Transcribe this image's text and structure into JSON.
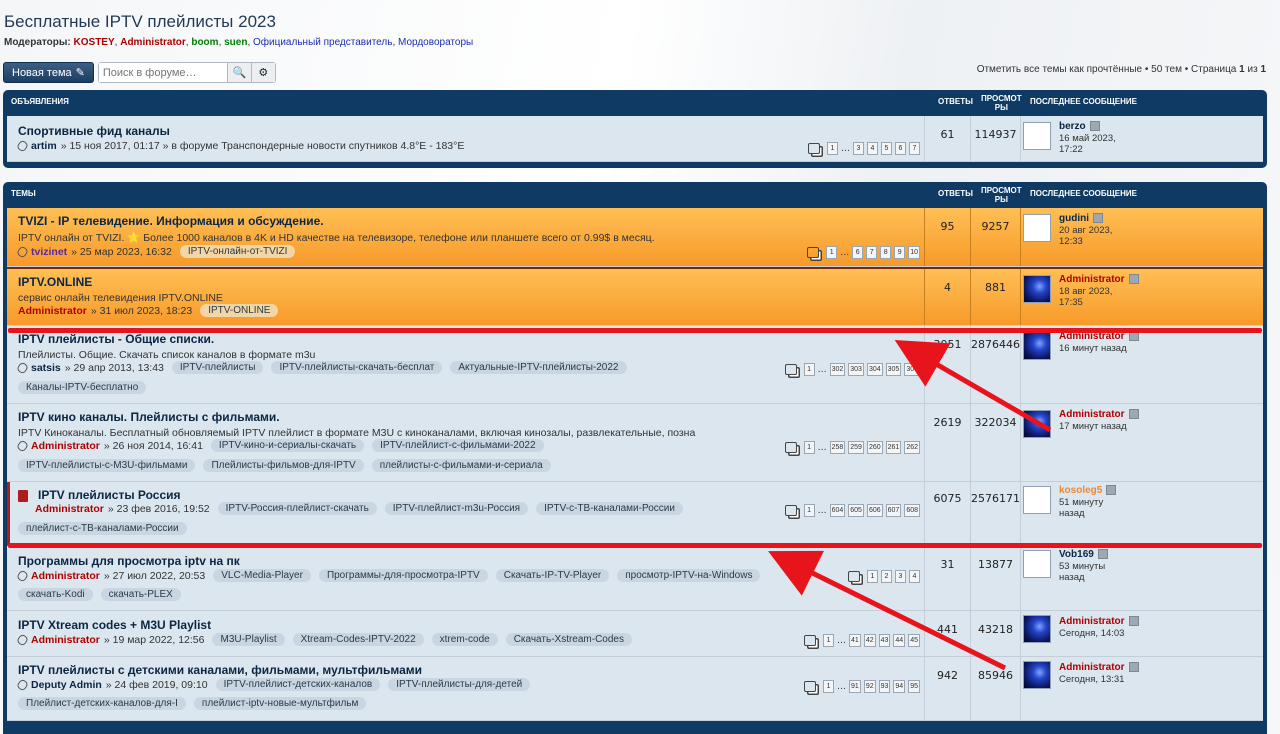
{
  "forum_title": "Бесплатные IPTV плейлисты 2023",
  "moderators": {
    "label": "Модераторы:",
    "list": [
      {
        "name": "KOSTEY",
        "color": "#b00000"
      },
      {
        "name": "Administrator",
        "color": "#b00000"
      },
      {
        "name": "boom",
        "color": "#008000"
      },
      {
        "name": "suen",
        "color": "#008000"
      },
      {
        "name": "Официальный представитель",
        "color": "#1d2eb0"
      },
      {
        "name": "Мордовораторы",
        "color": "#1d2eb0"
      }
    ]
  },
  "toolbar": {
    "new_topic": "Новая тема",
    "search_placeholder": "Поиск в форуме…",
    "mark_read": "Отметить все темы как прочтённые",
    "topics_count": "50 тем",
    "page_label": "Страница",
    "page_current": "1",
    "page_of": "из",
    "page_total": "1"
  },
  "columns": {
    "answers": "ОТВЕТЫ",
    "views_1": "ПРОСМОТ",
    "views_2": "РЫ",
    "last": "ПОСЛЕДНЕЕ СООБЩЕНИЕ"
  },
  "announcements": {
    "header": "ОБЪЯВЛЕНИЯ",
    "topics": [
      {
        "title": "Спортивные фид каналы",
        "author": "artim",
        "date": "» 15 ноя 2017, 01:17 » в форуме Транспондерные новости спутников 4.8°E - 183°E",
        "pages": [
          "1",
          "3",
          "4",
          "5",
          "6",
          "7"
        ],
        "replies": "61",
        "views": "114937",
        "last_author": "berzo",
        "last_date_1": "16 май 2023,",
        "last_date_2": "17:22"
      }
    ]
  },
  "topics_section": {
    "header": "ТЕМЫ",
    "topics": [
      {
        "title": "TVIZI - IP телевидение. Информация и обсуждение.",
        "desc": "IPTV онлайн от TVIZI. ⭐ Более 1000 каналов в 4K и HD качестве на телевизоре, телефоне или планшете всего от 0.99$ в месяц.",
        "author": "tvizinet",
        "date": "» 25 мар 2023, 16:32",
        "tags": [
          "IPTV-онлайн-от-TVIZI"
        ],
        "pages": [
          "1",
          "6",
          "7",
          "8",
          "9",
          "10"
        ],
        "replies": "95",
        "views": "9257",
        "last_author": "gudini",
        "last_date_1": "20 авг 2023,",
        "last_date_2": "12:33"
      },
      {
        "title": "IPTV.ONLINE",
        "desc": "сервис онлайн телевидения IPTV.ONLINE",
        "author": "Administrator",
        "date": "» 31 июл 2023, 18:23",
        "tags": [
          "IPTV-ONLINE"
        ],
        "replies": "4",
        "views": "881",
        "last_author": "Administrator",
        "last_date_1": "18 авг 2023,",
        "last_date_2": "17:35"
      },
      {
        "title": "IPTV плейлисты - Общие списки.",
        "desc": "Плейлисты. Общие. Скачать список каналов в формате m3u",
        "author": "satsis",
        "date": "» 29 апр 2013, 13:43",
        "tags": [
          "IPTV-плейлисты",
          "IPTV-плейлисты-скачать-бесплат",
          "Актуальные-IPTV-плейлисты-2022"
        ],
        "tags2": [
          "Каналы-IPTV-бесплатно"
        ],
        "pages": [
          "1",
          "302",
          "303",
          "304",
          "305",
          "306"
        ],
        "replies": "3051",
        "views": "2876446",
        "last_author": "Administrator",
        "last_date_1": "16 минут назад",
        "last_date_2": ""
      },
      {
        "title": "IPTV кино каналы. Плейлисты с фильмами.",
        "desc": "IPTV Киноканалы. Бесплатный обновляемый IPTV плейлист в формате M3U с киноканалами, включая кинозалы, развлекательные, позна",
        "author": "Administrator",
        "date": "» 26 ноя 2014, 16:41",
        "tags": [
          "IPTV-кино-и-сериалы-скачать",
          "IPTV-плейлист-с-фильмами-2022"
        ],
        "tags2": [
          "IPTV-плейлисты-с-M3U-фильмами",
          "Плейлисты-фильмов-для-IPTV",
          "плейлисты-с-фильмами-и-сериала"
        ],
        "pages": [
          "1",
          "258",
          "259",
          "260",
          "261",
          "262"
        ],
        "replies": "2619",
        "views": "322034",
        "last_author": "Administrator",
        "last_date_1": "17 минут назад",
        "last_date_2": ""
      },
      {
        "title": "IPTV плейлисты Россия",
        "author": "Administrator",
        "date": "» 23 фев 2016, 19:52",
        "tags": [
          "IPTV-Россия-плейлист-скачать",
          "IPTV-плейлист-m3u-Россия",
          "IPTV-с-ТВ-каналами-России"
        ],
        "tags2": [
          "плейлист-с-ТВ-каналами-России"
        ],
        "pages": [
          "1",
          "604",
          "605",
          "606",
          "607",
          "608"
        ],
        "replies": "6075",
        "views": "2576171",
        "last_author": "kosoleg5",
        "last_date_1": "51 минуту",
        "last_date_2": "назад"
      },
      {
        "title": "Программы для просмотра iptv на пк",
        "author": "Administrator",
        "date": "» 27 июл 2022, 20:53",
        "tags": [
          "VLC-Media-Player",
          "Программы-для-просмотра-IPTV",
          "Скачать-IP-TV-Player",
          "просмотр-IPTV-на-Windows"
        ],
        "tags2": [
          "скачать-Kodi",
          "скачать-PLEX"
        ],
        "pages": [
          "1",
          "2",
          "3",
          "4"
        ],
        "replies": "31",
        "views": "13877",
        "last_author": "Vob169",
        "last_date_1": "53 минуты",
        "last_date_2": "назад"
      },
      {
        "title": "IPTV Xtream codes + M3U Playlist",
        "author": "Administrator",
        "date": "» 19 мар 2022, 12:56",
        "tags": [
          "M3U-Playlist",
          "Xtream-Codes-IPTV-2022",
          "xtrem-code",
          "Скачать-Xstream-Codes"
        ],
        "pages": [
          "1",
          "41",
          "42",
          "43",
          "44",
          "45"
        ],
        "replies": "441",
        "views": "43218",
        "last_author": "Administrator",
        "last_date_1": "Сегодня, 14:03",
        "last_date_2": ""
      },
      {
        "title": "IPTV плейлисты с детскими каналами, фильмами, мультфильмами",
        "author": "Deputy Admin",
        "date": "» 24 фев 2019, 09:10",
        "tags": [
          "IPTV-плейлист-детских-каналов",
          "IPTV-плейлисты-для-детей"
        ],
        "tags2": [
          "Плейлист-детских-каналов-для-I",
          "плейлист-iptv-новые-мультфильм"
        ],
        "pages": [
          "1",
          "91",
          "92",
          "93",
          "94",
          "95"
        ],
        "replies": "942",
        "views": "85946",
        "last_author": "Administrator",
        "last_date_1": "Сегодня, 13:31",
        "last_date_2": ""
      }
    ]
  },
  "colors": {
    "admin": "#b00000",
    "kosoleg5": "#e98a3a",
    "normal": "#0b2643",
    "accent": "#e8141c"
  }
}
